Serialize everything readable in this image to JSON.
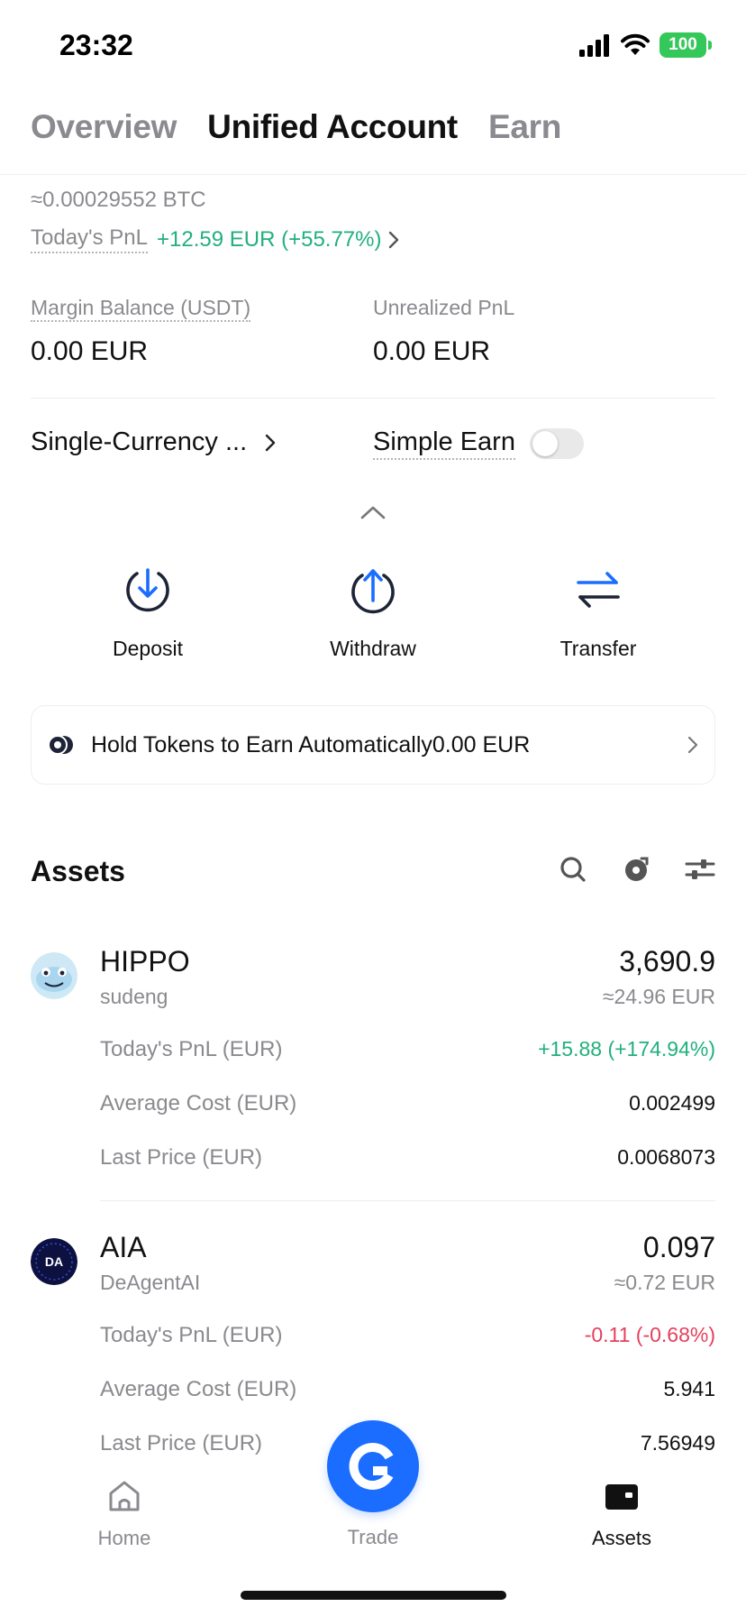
{
  "status_bar": {
    "time": "23:32",
    "battery": "100"
  },
  "tabs": [
    {
      "label": "Overview"
    },
    {
      "label": "Unified Account"
    },
    {
      "label": "Earn"
    }
  ],
  "account": {
    "btc_approx": "≈0.00029552 BTC",
    "todays_pnl_label": "Today's PnL",
    "todays_pnl_value": "+12.59 EUR (+55.77%)",
    "margin_balance_label": "Margin Balance (USDT)",
    "margin_balance_value": "0.00 EUR",
    "unrealized_pnl_label": "Unrealized PnL",
    "unrealized_pnl_value": "0.00 EUR",
    "mode_label": "Single-Currency ...",
    "simple_earn_label": "Simple Earn",
    "simple_earn_enabled": false
  },
  "actions": [
    {
      "label": "Deposit",
      "icon": "deposit-icon"
    },
    {
      "label": "Withdraw",
      "icon": "withdraw-icon"
    },
    {
      "label": "Transfer",
      "icon": "transfer-icon"
    }
  ],
  "earn_banner": {
    "text": "Hold Tokens to Earn Automatically0.00 EUR"
  },
  "assets": {
    "title": "Assets",
    "items": [
      {
        "symbol": "HIPPO",
        "name": "sudeng",
        "amount": "3,690.9",
        "fiat": "≈24.96 EUR",
        "pnl_label": "Today's PnL (EUR)",
        "pnl_value": "+15.88 (+174.94%)",
        "pnl_color": "#22b07d",
        "avg_cost_label": "Average Cost (EUR)",
        "avg_cost_value": "0.002499",
        "last_price_label": "Last Price (EUR)",
        "last_price_value": "0.0068073"
      },
      {
        "symbol": "AIA",
        "name": "DeAgentAI",
        "amount": "0.097",
        "fiat": "≈0.72 EUR",
        "pnl_label": "Today's PnL (EUR)",
        "pnl_value": "-0.11 (-0.68%)",
        "pnl_color": "#e5405e",
        "avg_cost_label": "Average Cost (EUR)",
        "avg_cost_value": "5.941",
        "last_price_label": "Last Price (EUR)",
        "last_price_value": "7.56949",
        "logo_text": "DA"
      }
    ]
  },
  "tabbar": [
    {
      "label": "Home",
      "icon": "home-icon"
    },
    {
      "label": "Trade",
      "icon": "trade-icon"
    },
    {
      "label": "Assets",
      "icon": "wallet-icon"
    }
  ],
  "colors": {
    "accent": "#1a6dff",
    "positive": "#22b07d",
    "negative": "#e5405e"
  }
}
